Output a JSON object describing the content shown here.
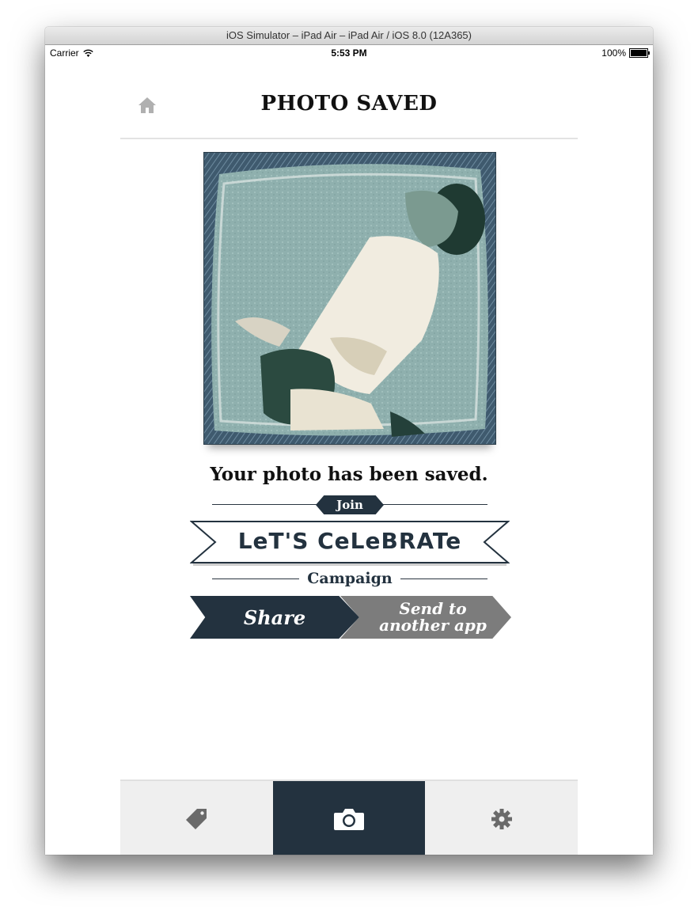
{
  "window": {
    "title": "iOS Simulator – iPad Air – iPad Air / iOS 8.0 (12A365)"
  },
  "statusbar": {
    "carrier": "Carrier",
    "time": "5:53 PM",
    "battery": "100%"
  },
  "header": {
    "title": "PHOTO SAVED",
    "home_icon": "home-icon"
  },
  "main": {
    "saved_message": "Your photo has been saved.",
    "join_label": "Join",
    "banner_text": "LeT'S CeLeBRATe",
    "campaign_label": "Campaign",
    "share_label": "Share",
    "send_label": "Send to another app"
  },
  "tabs": [
    {
      "icon": "tag-icon",
      "active": false
    },
    {
      "icon": "camera-icon",
      "active": true
    },
    {
      "icon": "gear-icon",
      "active": false
    }
  ],
  "colors": {
    "navy": "#23323f",
    "gray_button": "#7c7c7c",
    "tab_bg": "#efefef",
    "inactive_icon": "#6a6a6a"
  }
}
